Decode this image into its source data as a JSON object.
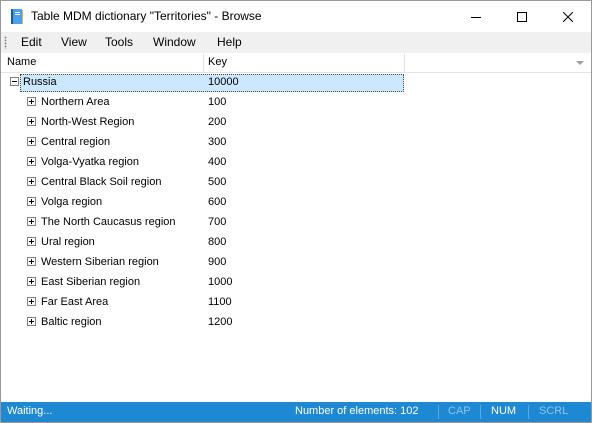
{
  "window": {
    "title": "Table MDM dictionary \"Territories\" - Browse",
    "icon": "book-icon",
    "controls": [
      "minimize-icon",
      "maximize-icon",
      "close-icon"
    ]
  },
  "menu": [
    "Edit",
    "View",
    "Tools",
    "Window",
    "Help"
  ],
  "columns": {
    "name": "Name",
    "key": "Key"
  },
  "tree": {
    "root": {
      "name": "Russia",
      "key": "10000",
      "expanded": true,
      "selected": true
    },
    "children": [
      {
        "name": "Northern Area",
        "key": "100"
      },
      {
        "name": "North-West Region",
        "key": "200"
      },
      {
        "name": "Central region",
        "key": "300"
      },
      {
        "name": "Volga-Vyatka region",
        "key": "400"
      },
      {
        "name": "Central Black Soil region",
        "key": "500"
      },
      {
        "name": "Volga region",
        "key": "600"
      },
      {
        "name": "The North Caucasus region",
        "key": "700"
      },
      {
        "name": "Ural region",
        "key": "800"
      },
      {
        "name": "Western Siberian region",
        "key": "900"
      },
      {
        "name": "East Siberian region",
        "key": "1000"
      },
      {
        "name": "Far East Area",
        "key": "1100"
      },
      {
        "name": "Baltic region",
        "key": "1200"
      }
    ]
  },
  "status": {
    "state": "Waiting...",
    "count": "Number of elements: 102",
    "cap": "CAP",
    "num": "NUM",
    "scrl": "SCRL"
  },
  "colors": {
    "status_bar": "#1e88d2",
    "selection": "#cce8ff",
    "menu_bar": "#f0f0f0"
  }
}
